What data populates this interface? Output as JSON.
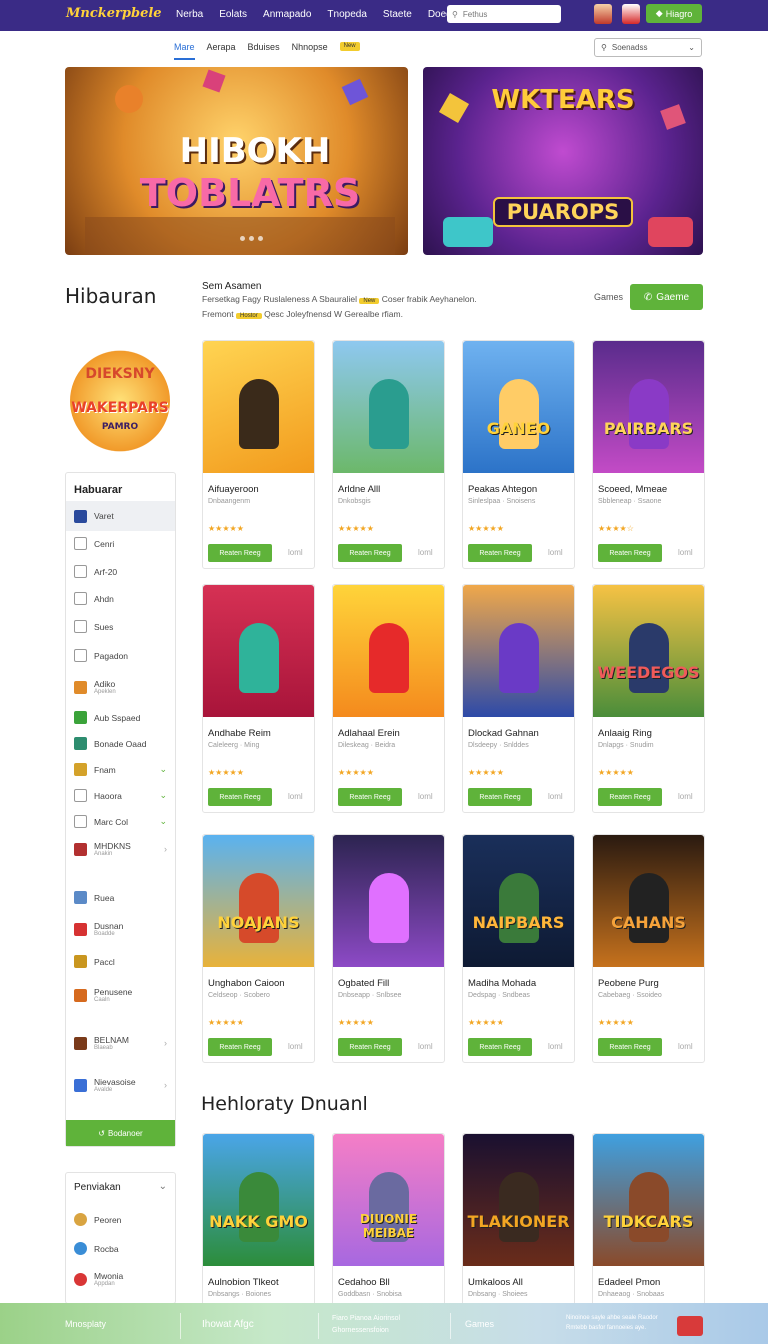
{
  "app": {
    "logo": "Mnckerpbele"
  },
  "topnav": [
    "Nerba",
    "Eolats",
    "Anmapado",
    "Tnopeda",
    "Staete",
    "Doeda"
  ],
  "search": {
    "placeholder": "Fethus"
  },
  "top_button": "Hiagro",
  "subnav": {
    "tabs": [
      "Mare",
      "Aerapa",
      "Bduises",
      "Nhnopse"
    ],
    "badge": "New",
    "sort": "Soenadss"
  },
  "heroes": [
    {
      "title_1": "HIBOKH",
      "title_2": "TOBLATRS"
    },
    {
      "title_1": "WKTEARS",
      "title_2": "PUAROPS"
    }
  ],
  "section": {
    "title": "Hibauran",
    "intro_title": "Sem Asamen",
    "intro_line1": "Fersetkag Fagy Ruslaleness A Sbauraliel",
    "intro_tag1": "New",
    "intro_line1b": "Coser frabik Aeyhanelon.",
    "intro_line2a": "Fremont",
    "intro_tag2": "Hostor",
    "intro_line2b": "Qesc Joleyfnensd W Gerealbe rfiam.",
    "games_label": "Games",
    "games_button": "Gaeme"
  },
  "sidebar_logo": {
    "l1": "DIEKSNY",
    "l2": "WAKERPARS",
    "l3": "PAMRO"
  },
  "sidebar": {
    "title": "Habuarar",
    "items": [
      {
        "label": "Varet",
        "icon": "chart-icon",
        "sub": ""
      },
      {
        "label": "Cenri",
        "icon": "monitor-icon",
        "sub": ""
      },
      {
        "label": "Arf-20",
        "icon": "users-icon",
        "sub": ""
      },
      {
        "label": "Ahdn",
        "icon": "user-icon",
        "sub": ""
      },
      {
        "label": "Sues",
        "icon": "person-icon",
        "sub": ""
      },
      {
        "label": "Pagadon",
        "icon": "page-icon",
        "sub": ""
      },
      {
        "label": "Adiko",
        "icon": "game-icon",
        "sub": "Apeklen"
      },
      {
        "label": "Aub Sspaed",
        "icon": "leaf-icon",
        "sub": ""
      },
      {
        "label": "Bonade Oaad",
        "icon": "box-icon",
        "sub": ""
      },
      {
        "label": "Fnam",
        "icon": "sword-icon",
        "sub": ""
      },
      {
        "label": "Haoora",
        "icon": "grid-icon",
        "sub": ""
      },
      {
        "label": "Marc Col",
        "icon": "circle-icon",
        "sub": ""
      },
      {
        "label": "MHDKNS",
        "icon": "poster-icon",
        "sub": "Anakin"
      },
      {
        "label": "Ruea",
        "icon": "cube-icon",
        "sub": ""
      },
      {
        "label": "Dusnan",
        "icon": "apple-icon",
        "sub": "Boadde"
      },
      {
        "label": "Paccl",
        "icon": "barrel-icon",
        "sub": ""
      },
      {
        "label": "Penusene",
        "icon": "ninja-icon",
        "sub": "Caaln"
      },
      {
        "label": "BELNAM",
        "icon": "mage-icon",
        "sub": "Blaeab"
      },
      {
        "label": "Nievasoise",
        "icon": "globe-icon",
        "sub": "Avalde"
      }
    ],
    "button": "Bodanoer"
  },
  "sidebar2": {
    "title": "Penviakan",
    "items": [
      {
        "label": "Peoren",
        "icon": "coin-icon"
      },
      {
        "label": "Rocba",
        "icon": "planet-icon"
      },
      {
        "label": "Mwonia",
        "sub": "Appdan",
        "icon": "ball-icon"
      }
    ]
  },
  "cards": [
    {
      "title": "Aifuayeroon",
      "sub": "Dnbaangenm",
      "art": "",
      "play": "Reaten Reeg",
      "comments": "loml"
    },
    {
      "title": "Arldne Alll",
      "sub": "Dnkobsgis",
      "art": "",
      "play": "Reaten Reeg",
      "comments": "loml"
    },
    {
      "title": "Peakas Ahtegon",
      "sub": "Sinleslpaa · Snoisens",
      "art": "GANEO",
      "play": "Reaten Reeg",
      "comments": "loml"
    },
    {
      "title": "Scoeed, Mmeae",
      "sub": "Sbbleneap · Ssaone",
      "art": "PAIRBARS",
      "play": "Reaten Reeg",
      "comments": "loml"
    },
    {
      "title": "Andhabe Reim",
      "sub": "Caleleerg · Ming",
      "art": "",
      "play": "Reaten Reeg",
      "comments": "loml"
    },
    {
      "title": "Adlahaal Erein",
      "sub": "Dileskeag · Beidra",
      "art": "",
      "play": "Reaten Reeg",
      "comments": "loml"
    },
    {
      "title": "Dlockad Gahnan",
      "sub": "Dlsdeepy · Snlddes",
      "art": "",
      "play": "Reaten Reeg",
      "comments": "loml"
    },
    {
      "title": "Anlaaig Ring",
      "sub": "Dnlapgs · Snudim",
      "art": "WEEDEGOS",
      "play": "Reaten Reeg",
      "comments": "loml"
    },
    {
      "title": "Unghabon Caioon",
      "sub": "Celdseop · Scobero",
      "art": "NOAJANS",
      "play": "Reaten Reeg",
      "comments": "loml"
    },
    {
      "title": "Ogbated Fill",
      "sub": "Dnbseapp · Snlbsee",
      "art": "",
      "play": "Reaten Reeg",
      "comments": "loml"
    },
    {
      "title": "Madiha Mohada",
      "sub": "Dedspag · Sndbeas",
      "art": "NAIPBARS",
      "play": "Reaten Reeg",
      "comments": "loml"
    },
    {
      "title": "Peobene Purg",
      "sub": "Cabebaeg · Ssoideo",
      "art": "CAHANS",
      "play": "Reaten Reeg",
      "comments": "loml"
    },
    {
      "title": "Aulnobion Tlkeot",
      "sub": "Dnbsangs · Boiones",
      "art": "NAKK GMO",
      "play": "",
      "comments": ""
    },
    {
      "title": "Cedahoo Bll",
      "sub": "Goddbasn · Snobisa",
      "art": "DIUONIE MEIBAE",
      "play": "",
      "comments": ""
    },
    {
      "title": "Umkaloos All",
      "sub": "Dnbsang · Shoiees",
      "art": "TLAKIONER",
      "play": "",
      "comments": ""
    },
    {
      "title": "Edadeel Pmon",
      "sub": "Dnhaeaog · Snobaas",
      "art": "TIDKCARS",
      "play": "",
      "comments": ""
    }
  ],
  "ratings": [
    5,
    5,
    5,
    4,
    5,
    5,
    5,
    5,
    5,
    5,
    5,
    5
  ],
  "section2": {
    "title": "Hehloraty Dnuanl"
  },
  "footer": {
    "col1": "Mnosplaty",
    "col2": "Ihowat Afgc",
    "col3a": "Fiaro Pianoa Aiorinsol",
    "col3b": "Ghornessensfoion",
    "col4": "Games",
    "col5a": "Ninoinoe sayle ahbe seale Raodor",
    "col5b": "Rmtebb basfor fannoeies aye."
  },
  "colors": {
    "brand": "#3a2b86",
    "accent": "#5fb33a",
    "link": "#2a6fd6",
    "star": "#f2a623",
    "tag": "#f2cc2e"
  }
}
